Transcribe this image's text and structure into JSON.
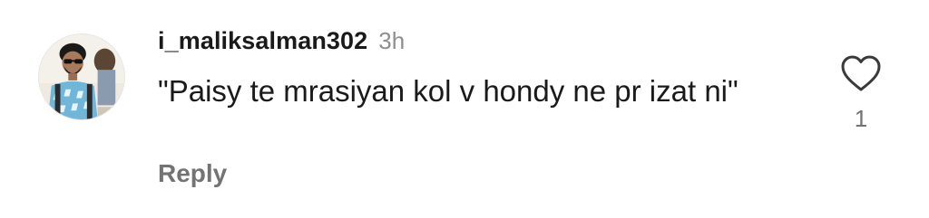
{
  "comment": {
    "username": "i_maliksalman302",
    "time": "3h",
    "text": "\"Paisy te mrasiyan kol v hondy ne pr izat ni\"",
    "reply_label": "Reply",
    "like_count": "1",
    "icons": {
      "like": "heart-outline-icon",
      "avatar": "user-avatar"
    },
    "colors": {
      "text": "#1a1a1a",
      "muted": "#8e8e8e",
      "reply": "#737373"
    }
  }
}
